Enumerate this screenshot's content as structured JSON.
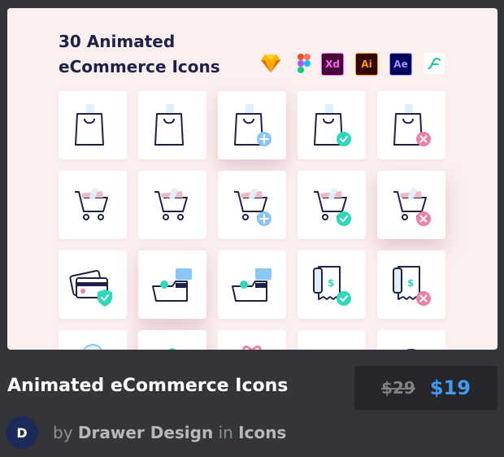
{
  "preview": {
    "title_line1": "30 Animated",
    "title_line2": "eCommerce Icons",
    "tools": [
      {
        "name": "sketch-icon",
        "label": ""
      },
      {
        "name": "figma-icon",
        "label": ""
      },
      {
        "name": "adobe-xd-icon",
        "label": "Xd"
      },
      {
        "name": "adobe-illustrator-icon",
        "label": "Ai"
      },
      {
        "name": "after-effects-icon",
        "label": "Ae"
      },
      {
        "name": "lottie-icon",
        "label": ""
      }
    ],
    "icons": [
      {
        "name": "shopping-bag-icon",
        "kind": "bag",
        "badge": "none",
        "lifted": false
      },
      {
        "name": "shopping-bag-icon",
        "kind": "bag",
        "badge": "none",
        "lifted": false
      },
      {
        "name": "shopping-bag-add-icon",
        "kind": "bag",
        "badge": "plus",
        "lifted": true
      },
      {
        "name": "shopping-bag-check-icon",
        "kind": "bag",
        "badge": "check",
        "lifted": false
      },
      {
        "name": "shopping-bag-remove-icon",
        "kind": "bag",
        "badge": "x",
        "lifted": false
      },
      {
        "name": "cart-icon",
        "kind": "cart",
        "badge": "none",
        "lifted": false
      },
      {
        "name": "cart-icon",
        "kind": "cart",
        "badge": "none",
        "lifted": false
      },
      {
        "name": "cart-add-icon",
        "kind": "cart",
        "badge": "plus",
        "lifted": false
      },
      {
        "name": "cart-check-icon",
        "kind": "cart",
        "badge": "check",
        "lifted": false
      },
      {
        "name": "cart-remove-icon",
        "kind": "cart",
        "badge": "x",
        "lifted": true
      },
      {
        "name": "secure-payment-icon",
        "kind": "cards",
        "badge": "shield",
        "lifted": false
      },
      {
        "name": "card-payment-check-icon",
        "kind": "wallet",
        "badge": "none",
        "lifted": true
      },
      {
        "name": "card-payment-cancel-icon",
        "kind": "wallet",
        "badge": "none",
        "lifted": false
      },
      {
        "name": "receipt-check-icon",
        "kind": "receipt",
        "badge": "check",
        "lifted": false
      },
      {
        "name": "receipt-remove-icon",
        "kind": "receipt",
        "badge": "x",
        "lifted": false
      },
      {
        "name": "location-pin-icon",
        "kind": "pin",
        "badge": "none",
        "lifted": false
      },
      {
        "name": "box-icon",
        "kind": "box",
        "badge": "none",
        "lifted": true
      },
      {
        "name": "gift-icon",
        "kind": "gift",
        "badge": "none",
        "lifted": false
      },
      {
        "name": "envelope-icon",
        "kind": "env",
        "badge": "none",
        "lifted": false
      },
      {
        "name": "globe-icon",
        "kind": "globe",
        "badge": "none",
        "lifted": false
      }
    ]
  },
  "item": {
    "title": "Animated eCommerce Icons",
    "old_price": "$29",
    "price": "$19"
  },
  "author": {
    "avatar_letter": "D",
    "by": "by",
    "name": "Drawer Design",
    "in": "in",
    "category": "Icons"
  },
  "colors": {
    "preview_bg": "#fcefef",
    "navy": "#1e2248",
    "accent_green": "#2fd8b8",
    "accent_blue": "#8ac7f5",
    "accent_pink": "#f07fa8",
    "price_blue": "#3e9bf1"
  }
}
